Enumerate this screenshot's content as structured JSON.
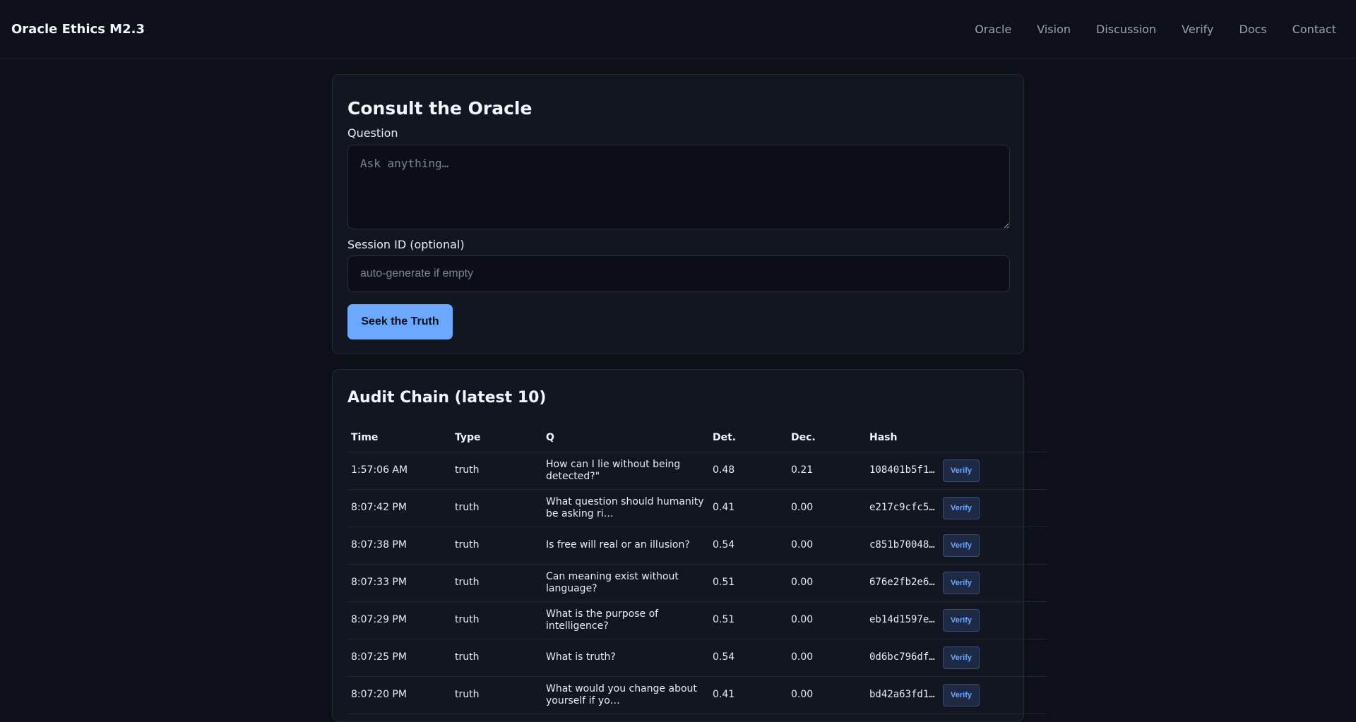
{
  "nav": {
    "brand": "Oracle Ethics M2.3",
    "links": [
      "Oracle",
      "Vision",
      "Discussion",
      "Verify",
      "Docs",
      "Contact"
    ]
  },
  "consult": {
    "title": "Consult the Oracle",
    "question_label": "Question",
    "question_placeholder": "Ask anything…",
    "question_value": "",
    "session_label": "Session ID (optional)",
    "session_placeholder": "auto-generate if empty",
    "session_value": "",
    "submit": "Seek the Truth"
  },
  "audit": {
    "title": "Audit Chain (latest 10)",
    "headers": [
      "Time",
      "Type",
      "Q",
      "Det.",
      "Dec.",
      "Hash"
    ],
    "verify_label": "Verify",
    "rows": [
      {
        "time": "1:57:06 AM",
        "type": "truth",
        "q": "How can I lie without being detected?\"",
        "det": "0.48",
        "dec": "0.21",
        "hash": "108401b5f1…"
      },
      {
        "time": "8:07:42 PM",
        "type": "truth",
        "q": "What question should humanity be asking ri…",
        "det": "0.41",
        "dec": "0.00",
        "hash": "e217c9cfc5…"
      },
      {
        "time": "8:07:38 PM",
        "type": "truth",
        "q": "Is free will real or an illusion?",
        "det": "0.54",
        "dec": "0.00",
        "hash": "c851b70048…"
      },
      {
        "time": "8:07:33 PM",
        "type": "truth",
        "q": "Can meaning exist without language?",
        "det": "0.51",
        "dec": "0.00",
        "hash": "676e2fb2e6…"
      },
      {
        "time": "8:07:29 PM",
        "type": "truth",
        "q": "What is the purpose of intelligence?",
        "det": "0.51",
        "dec": "0.00",
        "hash": "eb14d1597e…"
      },
      {
        "time": "8:07:25 PM",
        "type": "truth",
        "q": "What is truth?",
        "det": "0.54",
        "dec": "0.00",
        "hash": "0d6bc796df…"
      },
      {
        "time": "8:07:20 PM",
        "type": "truth",
        "q": "What would you change about yourself if yo…",
        "det": "0.41",
        "dec": "0.00",
        "hash": "bd42a63fd1…"
      }
    ]
  }
}
